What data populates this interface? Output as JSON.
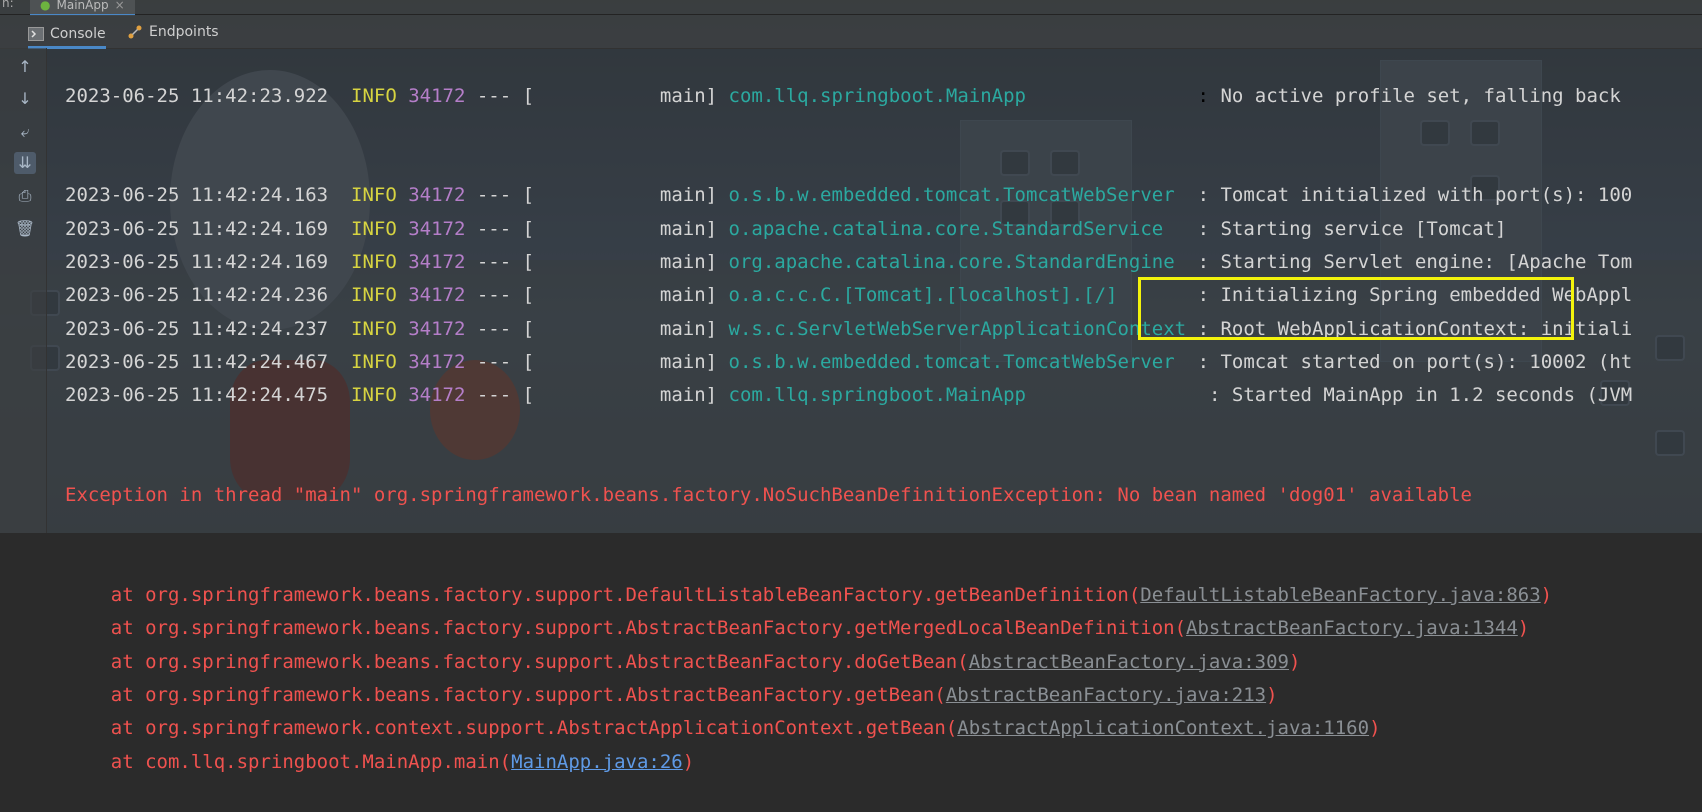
{
  "window": {
    "left_fragment": "n:",
    "run_tab": "MainApp",
    "run_tab_close": "×"
  },
  "toolbar": {
    "tabs": [
      {
        "label": "Console",
        "icon": "console-icon",
        "active": true
      },
      {
        "label": "Endpoints",
        "icon": "endpoints-icon",
        "active": false
      }
    ]
  },
  "sidebar": {
    "buttons": [
      {
        "name": "scroll-up-icon",
        "glyph": "↑"
      },
      {
        "name": "scroll-down-icon",
        "glyph": "↓"
      },
      {
        "name": "soft-wrap-icon",
        "glyph": "⤶"
      },
      {
        "name": "scroll-to-end-icon",
        "glyph": "⇊"
      },
      {
        "name": "print-icon",
        "glyph": "⎙"
      },
      {
        "name": "clear-icon",
        "glyph": "🗑"
      }
    ]
  },
  "colors": {
    "timestamp": "#d4d4d4",
    "level": "#d7d441",
    "pid": "#b57ec9",
    "logger": "#2ba9a0",
    "error": "#f0524f",
    "highlight": "#f3f30c"
  },
  "console": {
    "partial_top": {
      "ts": "2023-06-25 11:42:23.922",
      "level": "INFO",
      "pid": "34172",
      "sep": " --- [",
      "thread": "           main]",
      "logger": "com.llq.springboot.MainApp",
      "msg": "No active profile set, falling back"
    },
    "log_lines": [
      {
        "ts": "2023-06-25 11:42:24.163",
        "level": "INFO",
        "pid": "34172",
        "sep": " --- [",
        "thread": "           main]",
        "logger": "o.s.b.w.embedded.tomcat.TomcatWebServer ",
        "msg": ": Tomcat initialized with port(s): 100"
      },
      {
        "ts": "2023-06-25 11:42:24.169",
        "level": "INFO",
        "pid": "34172",
        "sep": " --- [",
        "thread": "           main]",
        "logger": "o.apache.catalina.core.StandardService  ",
        "msg": ": Starting service [Tomcat]"
      },
      {
        "ts": "2023-06-25 11:42:24.169",
        "level": "INFO",
        "pid": "34172",
        "sep": " --- [",
        "thread": "           main]",
        "logger": "org.apache.catalina.core.StandardEngine ",
        "msg": ": Starting Servlet engine: [Apache Tom"
      },
      {
        "ts": "2023-06-25 11:42:24.236",
        "level": "INFO",
        "pid": "34172",
        "sep": " --- [",
        "thread": "           main]",
        "logger": "o.a.c.c.C.[Tomcat].[localhost].[/]      ",
        "msg": ": Initializing Spring embedded WebAppl"
      },
      {
        "ts": "2023-06-25 11:42:24.237",
        "level": "INFO",
        "pid": "34172",
        "sep": " --- [",
        "thread": "           main]",
        "logger": "w.s.c.ServletWebServerApplicationContext",
        "msg": ": Root WebApplicationContext: initiali"
      },
      {
        "ts": "2023-06-25 11:42:24.467",
        "level": "INFO",
        "pid": "34172",
        "sep": " --- [",
        "thread": "           main]",
        "logger": "o.s.b.w.embedded.tomcat.TomcatWebServer ",
        "msg": ": Tomcat started on port(s): 10002 (ht"
      },
      {
        "ts": "2023-06-25 11:42:24.475",
        "level": "INFO",
        "pid": "34172",
        "sep": " --- [",
        "thread": "           main]",
        "logger": "com.llq.springboot.MainApp               ",
        "msg": ": Started MainApp in 1.2 seconds (JVM "
      }
    ],
    "exception": {
      "head": "Exception in thread \"main\" org.springframework.beans.factory.NoSuchBeanDefinitionException: ",
      "detail": "No bean named 'dog01' available"
    },
    "stack": [
      {
        "text": "    at org.springframework.beans.factory.support.DefaultListableBeanFactory.getBeanDefinition(",
        "link": "DefaultListableBeanFactory.java:863",
        "close": ")"
      },
      {
        "text": "    at org.springframework.beans.factory.support.AbstractBeanFactory.getMergedLocalBeanDefinition(",
        "link": "AbstractBeanFactory.java:1344",
        "close": ")"
      },
      {
        "text": "    at org.springframework.beans.factory.support.AbstractBeanFactory.doGetBean(",
        "link": "AbstractBeanFactory.java:309",
        "close": ")"
      },
      {
        "text": "    at org.springframework.beans.factory.support.AbstractBeanFactory.getBean(",
        "link": "AbstractBeanFactory.java:213",
        "close": ")"
      },
      {
        "text": "    at org.springframework.context.support.AbstractApplicationContext.getBean(",
        "link": "AbstractApplicationContext.java:1160",
        "close": ")"
      },
      {
        "text": "    at com.llq.springboot.MainApp.main(",
        "link": "MainApp.java:26",
        "close": ")",
        "primary": true
      }
    ]
  }
}
